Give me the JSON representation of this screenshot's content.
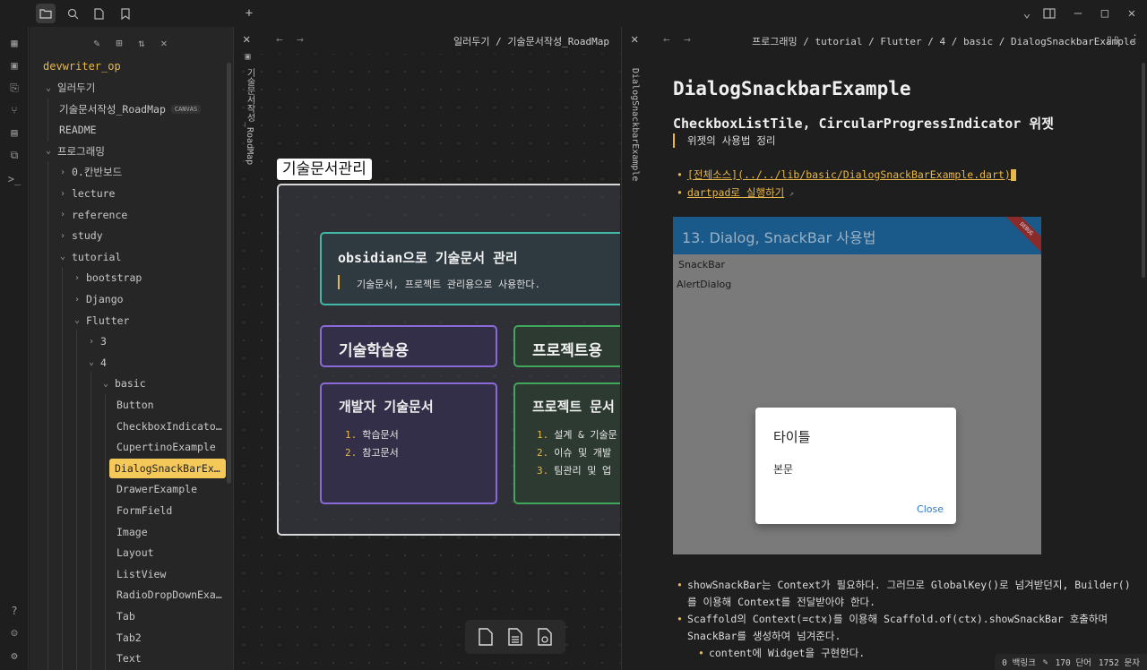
{
  "titlebar": {
    "icons": [
      "folder-icon",
      "search-icon",
      "file-icon",
      "bookmark-icon",
      "plus-icon"
    ],
    "window": [
      "chevron-down-icon",
      "sidebar-toggle-icon",
      "minimize-icon",
      "maximize-icon",
      "close-icon"
    ]
  },
  "sidebar": {
    "vault": "devwriter_op",
    "items": [
      {
        "label": "일러두기",
        "depth": 0,
        "chev": "open"
      },
      {
        "label": "기술문서작성_RoadMap",
        "depth": 1,
        "badge": "CANVAS"
      },
      {
        "label": "README",
        "depth": 1
      },
      {
        "label": "프로그래밍",
        "depth": 0,
        "chev": "open"
      },
      {
        "label": "0.칸반보드",
        "depth": 1,
        "chev": "closed"
      },
      {
        "label": "lecture",
        "depth": 1,
        "chev": "closed"
      },
      {
        "label": "reference",
        "depth": 1,
        "chev": "closed"
      },
      {
        "label": "study",
        "depth": 1,
        "chev": "closed"
      },
      {
        "label": "tutorial",
        "depth": 1,
        "chev": "open"
      },
      {
        "label": "bootstrap",
        "depth": 2,
        "chev": "closed"
      },
      {
        "label": "Django",
        "depth": 2,
        "chev": "closed"
      },
      {
        "label": "Flutter",
        "depth": 2,
        "chev": "open"
      },
      {
        "label": "3",
        "depth": 3,
        "chev": "closed"
      },
      {
        "label": "4",
        "depth": 3,
        "chev": "open"
      },
      {
        "label": "basic",
        "depth": 4,
        "chev": "open"
      },
      {
        "label": "Button",
        "depth": 5
      },
      {
        "label": "CheckboxIndicato…",
        "depth": 5
      },
      {
        "label": "CupertinoExample",
        "depth": 5
      },
      {
        "label": "DialogSnackBarEx…",
        "depth": 5,
        "selected": true
      },
      {
        "label": "DrawerExample",
        "depth": 5
      },
      {
        "label": "FormField",
        "depth": 5
      },
      {
        "label": "Image",
        "depth": 5
      },
      {
        "label": "Layout",
        "depth": 5
      },
      {
        "label": "ListView",
        "depth": 5
      },
      {
        "label": "RadioDropDownExa…",
        "depth": 5
      },
      {
        "label": "Tab",
        "depth": 5
      },
      {
        "label": "Tab2",
        "depth": 5
      },
      {
        "label": "Text",
        "depth": 5
      }
    ]
  },
  "canvas": {
    "breadcrumb": "일러두기 / 기술문서작성_RoadMap",
    "vertical_tab": "기술문서작성_RoadMap",
    "group_label": "기술문서관리",
    "card_main_title": "obsidian으로 기술문서 관리",
    "card_main_body": "기술문서, 프로젝트 관리용으로 사용한다.",
    "card_study": "기술학습용",
    "card_project": "프로젝트용",
    "card_devdocs_title": "개발자 기술문서",
    "card_devdocs_items": [
      "학습문서",
      "참고문서"
    ],
    "card_projdocs_title": "프로젝트 문서",
    "card_projdocs_items": [
      "설계 & 기술문",
      "이슈 및 개발",
      "팀관리 및 업"
    ]
  },
  "doc": {
    "breadcrumb": "프로그래밍 / tutorial / Flutter / 4 / basic / DialogSnackbarExample",
    "vertical_tab": "DialogSnackbarExample",
    "h1": "DialogSnackbarExample",
    "h2": "CheckboxListTile, CircularProgressIndicator 위젯",
    "quote": "위젯의 사용법 정리",
    "link1": "[전체소스](../../lib/basic/DialogSnackBarExample.dart)",
    "link2": "dartpad로 실행하기",
    "embed": {
      "appbar": "13. Dialog, SnackBar 사용법",
      "debug": "DEBUG",
      "item1": "SnackBar",
      "item2": "AlertDialog",
      "dialog_title": "타이틀",
      "dialog_body": "본문",
      "dialog_close": "Close"
    },
    "bullet1a": "showSnackBar는 Context가 필요하다. 그러므로 GlobalKey()로 넘겨받던지, Builder()",
    "bullet1b": "를 이용해 Context를 전달받아야 한다.",
    "bullet2a": "Scaffold의 Context(=ctx)를 이용해 Scaffold.of(ctx).showSnackBar 호출하며",
    "bullet2b": "SnackBar를 생성하여 넘겨준다.",
    "bullet3": "content에 Widget을 구현한다."
  },
  "status": {
    "backlinks": "0 백링크",
    "words": "170 단어",
    "chars": "1752 문자"
  }
}
